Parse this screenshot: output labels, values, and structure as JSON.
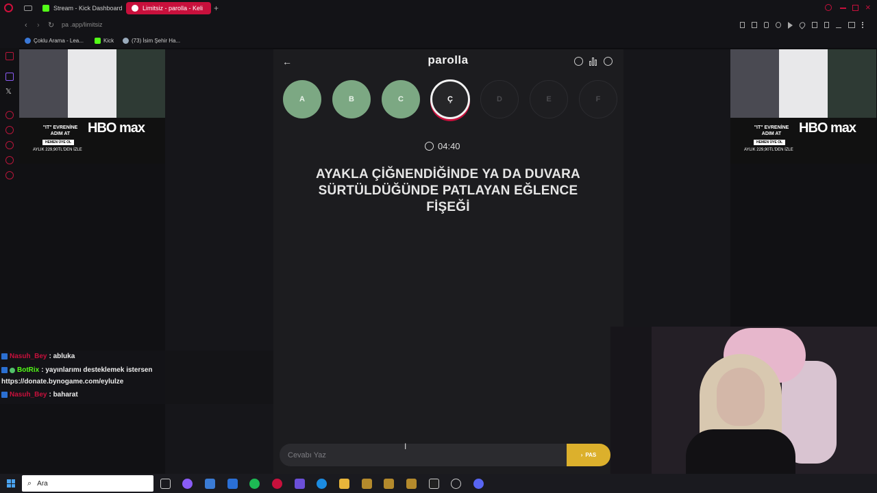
{
  "browser": {
    "tabs": [
      {
        "label": "Stream - Kick Dashboard"
      },
      {
        "label": "Limitsiz - parolla - Keli"
      }
    ],
    "url": "pa   .app/limitsiz",
    "bookmarks": [
      "Çoklu Arama - Lea...",
      "Kick",
      "(73) İsim Şehir Ha..."
    ]
  },
  "ad": {
    "tagline": "\"IT\" EVRENİNE ADIM AT",
    "brand": "HBO max",
    "cta": "HEMEN ÜYE OL",
    "price": "AYLIK 229,90TL'DEN İZLE"
  },
  "game": {
    "logo": "parolla",
    "letters": [
      {
        "char": "A",
        "state": "done"
      },
      {
        "char": "B",
        "state": "done"
      },
      {
        "char": "C",
        "state": "done"
      },
      {
        "char": "Ç",
        "state": "current"
      },
      {
        "char": "D",
        "state": "todo"
      },
      {
        "char": "E",
        "state": "todo"
      },
      {
        "char": "F",
        "state": "todo"
      }
    ],
    "timer": "04:40",
    "question": "AYAKLA ÇİĞNENDİĞİNDE YA DA DUVARA SÜRTÜLDÜĞÜNDE PATLAYAN EĞLENCE FİŞEĞİ",
    "answer_placeholder": "Cevabı Yaz",
    "pass_label": "PAS"
  },
  "chat": {
    "messages": [
      {
        "user": "Nasuh_Bey",
        "text": ": abluka"
      },
      {
        "user": "BotRix",
        "text": ": yayınlarımı desteklemek istersen"
      },
      {
        "user": "Nasuh_Bey",
        "text": ": baharat"
      }
    ],
    "continuation": "https://donate.bynogame.com/eylulze"
  },
  "taskbar": {
    "search_label": "Ara"
  },
  "colors": {
    "accent": "#c8103c",
    "letter_done": "#7ca883",
    "pass": "#dcb02c"
  }
}
